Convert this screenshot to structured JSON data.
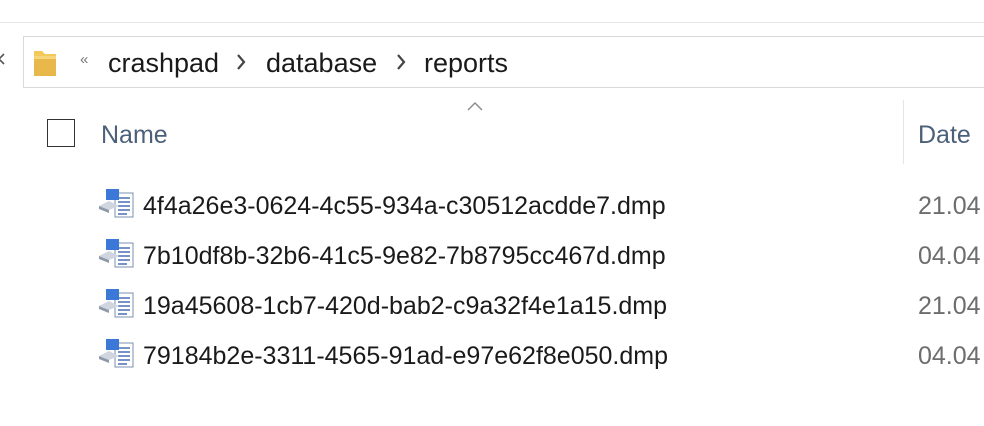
{
  "breadcrumb": {
    "overflow_symbol": "«",
    "items": [
      "crashpad",
      "database",
      "reports"
    ]
  },
  "columns": {
    "name": "Name",
    "date": "Date"
  },
  "files": [
    {
      "name": "4f4a26e3-0624-4c55-934a-c30512acdde7.dmp",
      "date": "21.04"
    },
    {
      "name": "7b10df8b-32b6-41c5-9e82-7b8795cc467d.dmp",
      "date": "04.04"
    },
    {
      "name": "19a45608-1cb7-420d-bab2-c9a32f4e1a15.dmp",
      "date": "21.04"
    },
    {
      "name": "79184b2e-3311-4565-91ad-e97e62f8e050.dmp",
      "date": "04.04"
    }
  ],
  "colors": {
    "folder": "#e8b84a",
    "header_text": "#4c607a",
    "date_text": "#6d6d6d"
  }
}
